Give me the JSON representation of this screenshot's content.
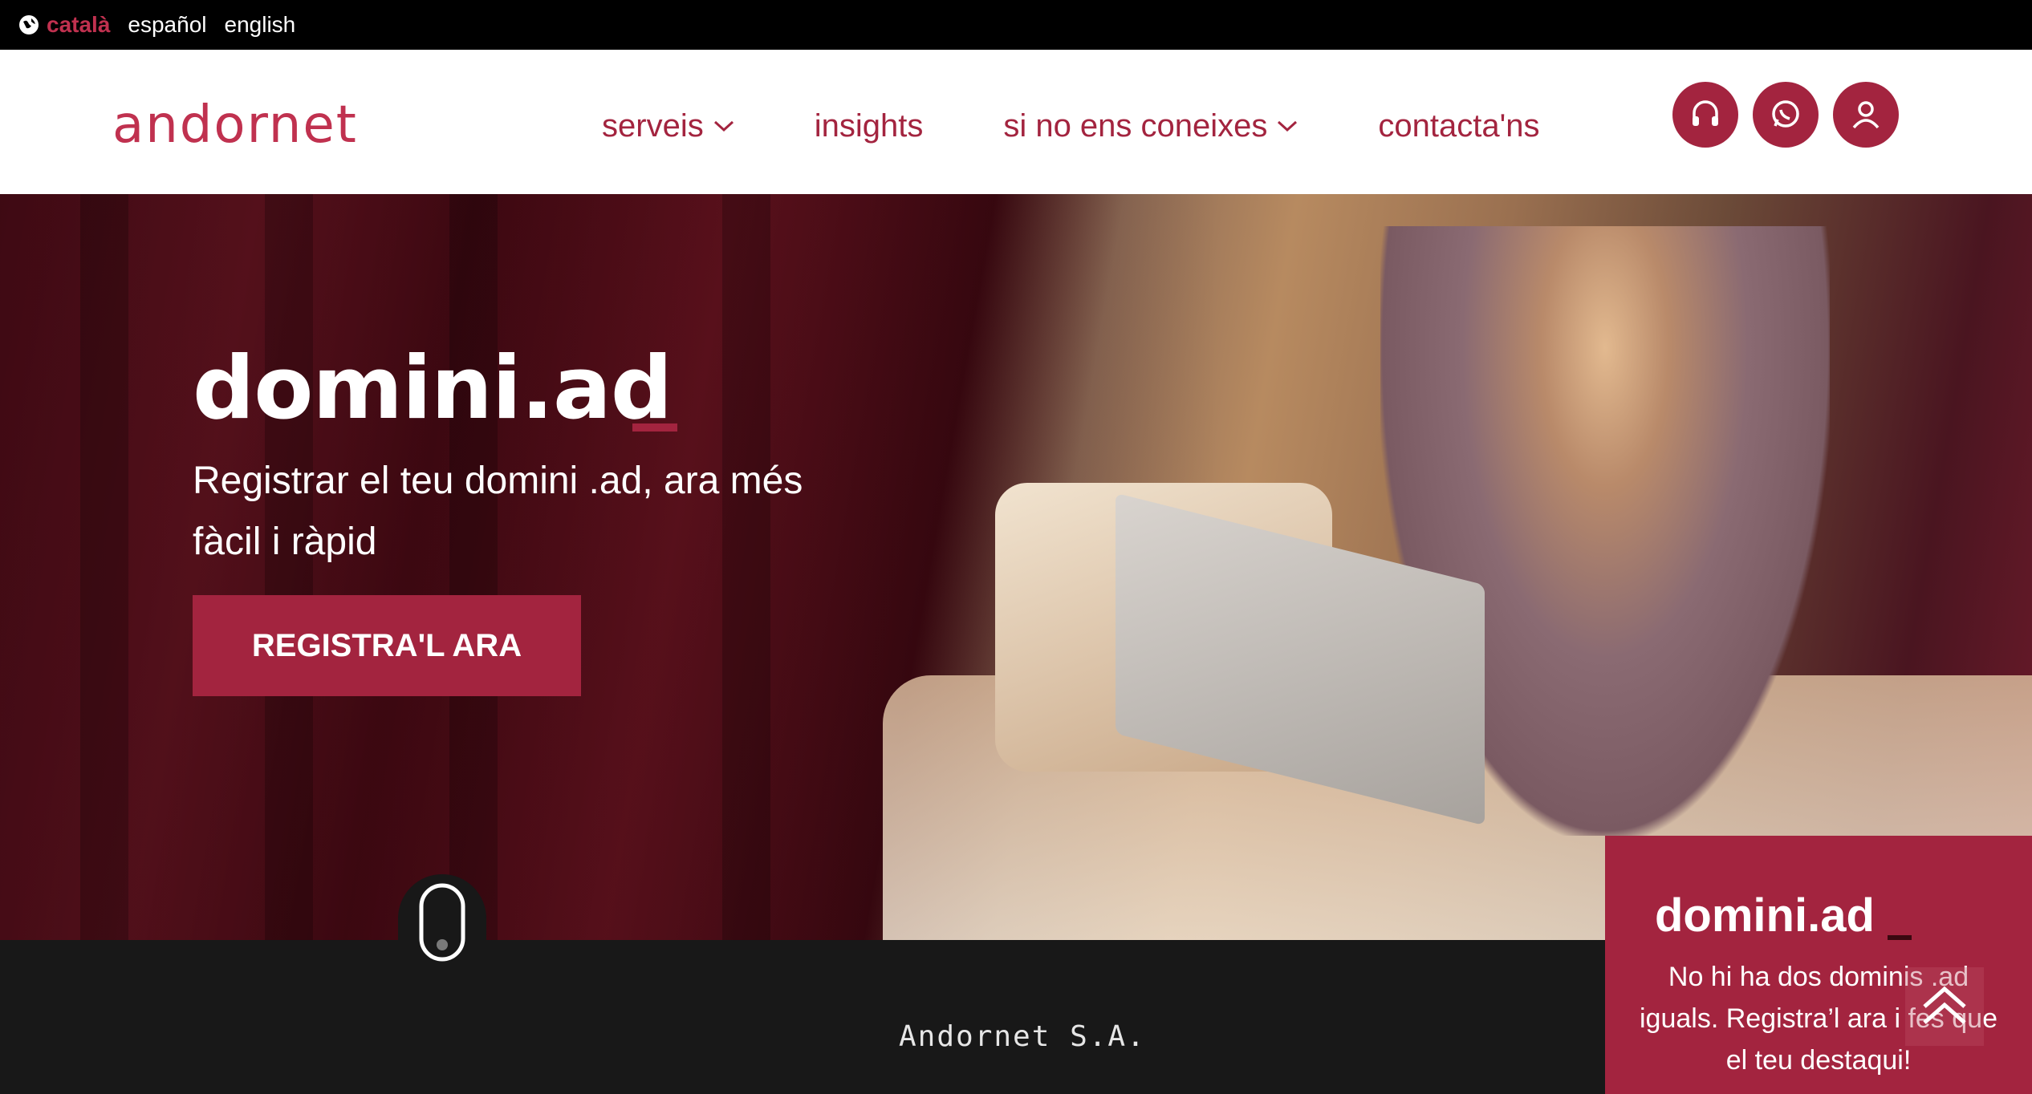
{
  "languages": [
    {
      "label": "català",
      "active": true
    },
    {
      "label": "español",
      "active": false
    },
    {
      "label": "english",
      "active": false
    }
  ],
  "brand": {
    "logo_text": "andornet",
    "accent": "#a3243f"
  },
  "nav": {
    "serveis": "serveis",
    "insights": "insights",
    "coneixes": "si no ens coneixes",
    "contact": "contacta'ns"
  },
  "header_icons": [
    "headset-icon",
    "whatsapp-icon",
    "user-icon"
  ],
  "hero": {
    "title": "domini.ad",
    "subtitle": "Registrar el teu domini .ad, ara més fàcil i ràpid",
    "cta": "REGISTRA'L ARA"
  },
  "promo": {
    "title": "domini.ad",
    "text": "No hi ha dos dominis .ad iguals. Registra’l ara i fes que el teu destaqui!"
  },
  "footer": {
    "company": "Andornet S.A."
  }
}
